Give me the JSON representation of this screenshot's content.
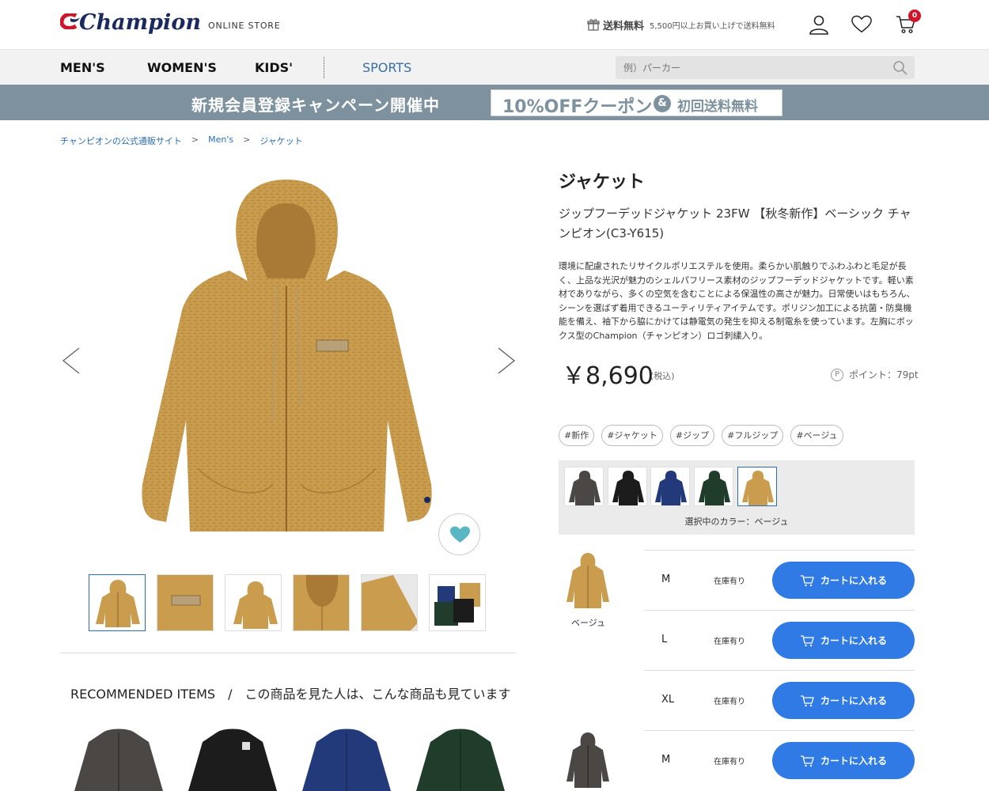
{
  "header": {
    "logo_text": "Champion",
    "online_store": "ONLINE STORE",
    "shipping_title": "送料無料",
    "shipping_note": "5,500円以上お買い上げで送料無料",
    "cart_count": "0"
  },
  "nav": {
    "items": [
      "MEN'S",
      "WOMEN'S",
      "KIDS'"
    ],
    "sports": "SPORTS",
    "search_placeholder": "例）パーカー"
  },
  "banner": {
    "left": "新規会員登録キャンペーン開催中",
    "coupon": "10%OFFクーポン",
    "amp": "&",
    "free_shipping": "初回送料無料"
  },
  "breadcrumb": [
    "チャンピオンの公式通販サイト",
    "Men's",
    "ジャケット"
  ],
  "breadcrumb_sep": ">",
  "product": {
    "category": "ジャケット",
    "name": "ジップフーデッドジャケット 23FW 【秋冬新作】ベーシック チャンピオン(C3-Y615)",
    "description": "環境に配慮されたリサイクルポリエステルを使用。柔らかい肌触りでふわふわと毛足が長く、上品な光沢が魅力のシェルパフリース素材のジップフーデッドジャケットです。軽い素材でありながら、多くの空気を含むことによる保温性の高さが魅力。日常使いはもちろん、シーンを選ばず着用できるユーティリティアイテムです。ポリジン加工による抗菌・防臭機能を備え、袖下から脇にかけては静電気の発生を抑える制電糸を使っています。左胸にボックス型のChampion（チャンピオン）ロゴ刺繍入り。",
    "price": "￥8,690",
    "price_tax": "(税込)",
    "point_icon": "P",
    "point": "ポイント：79pt",
    "tags": [
      "#新作",
      "#ジャケット",
      "#ジップ",
      "#フルジップ",
      "#ベージュ"
    ],
    "selected_color_label": "選択中のカラー：ベージュ"
  },
  "colors": {
    "swatches": [
      "#4a4745",
      "#1c1c1c",
      "#233a7a",
      "#1f3d2a",
      "#c89a4a"
    ],
    "beige": "#c99c4e",
    "beige_dark": "#a87a35",
    "accent_blue": "#2f7ae5",
    "banner_gray": "#7d929e",
    "heart_teal": "#5bb6c4"
  },
  "variants": [
    {
      "label": "ベージュ",
      "sizes": [
        {
          "size": "M",
          "stock": "在庫有り",
          "button": "カートに入れる"
        },
        {
          "size": "L",
          "stock": "在庫有り",
          "button": "カートに入れる"
        },
        {
          "size": "XL",
          "stock": "在庫有り",
          "button": "カートに入れる"
        }
      ]
    },
    {
      "label": "",
      "sizes": [
        {
          "size": "M",
          "stock": "在庫有り",
          "button": "カートに入れる"
        }
      ]
    }
  ],
  "recommended": {
    "title": "RECOMMENDED ITEMS　/　この商品を見た人は、こんな商品も見ています"
  }
}
